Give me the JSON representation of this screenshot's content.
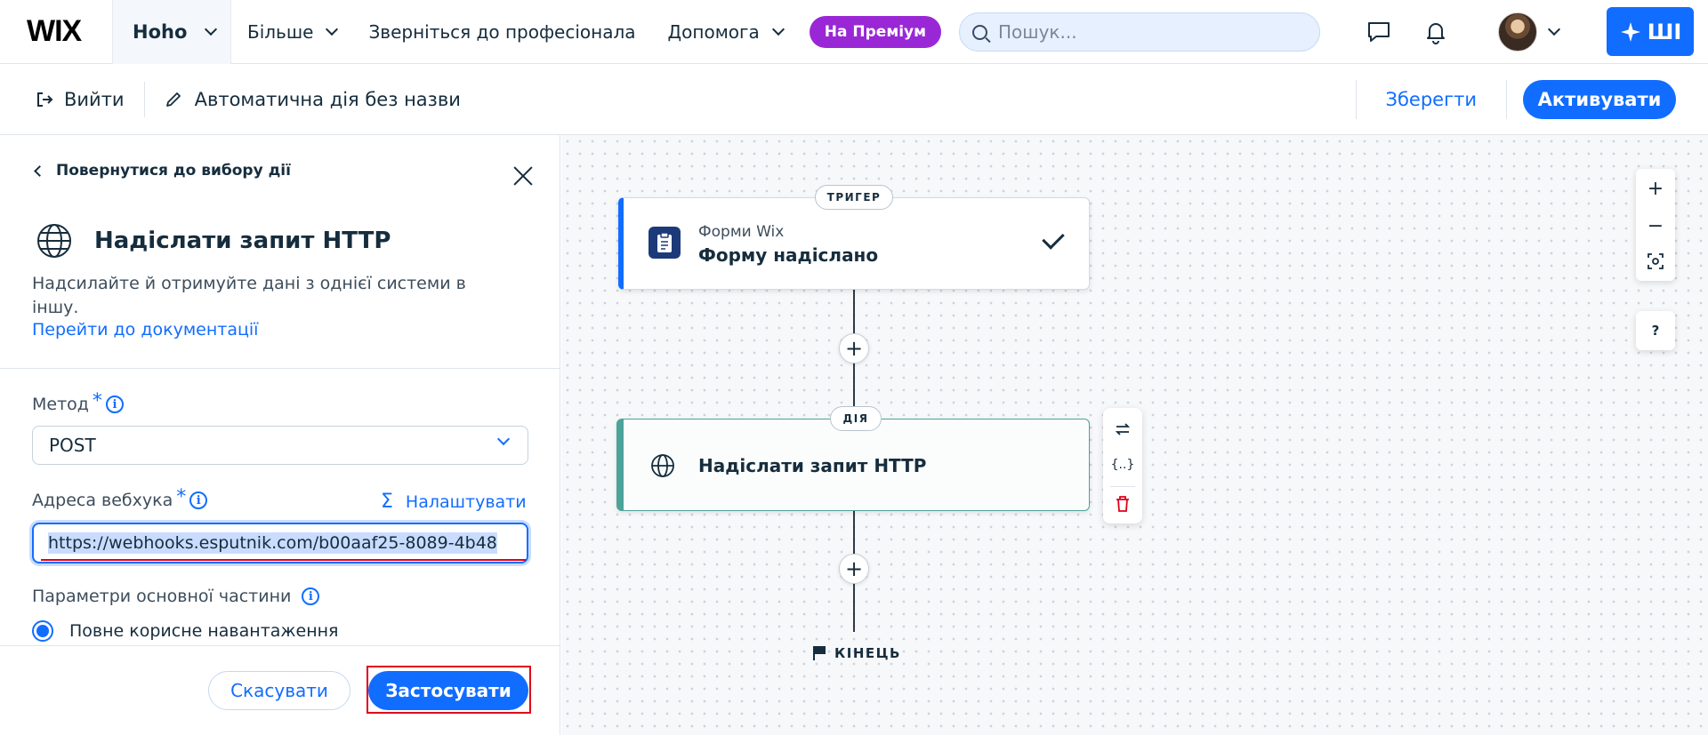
{
  "topbar": {
    "logo": "WIX",
    "site_name": "Hoho",
    "nav": [
      "Більше",
      "Зверніться до професіонала",
      "Допомога"
    ],
    "premium_label": "На Преміум",
    "search_placeholder": "Пошук...",
    "ai_label": "ШІ"
  },
  "toolbar": {
    "exit_label": "Вийти",
    "automation_title": "Автоматична дія без назви",
    "save_label": "Зберегти",
    "activate_label": "Активувати"
  },
  "panel": {
    "back_label": "Повернутися до вибору дії",
    "action_title": "Надіслати запит HTTP",
    "description": "Надсилайте й отримуйте дані з однієї системи в іншу.",
    "doc_link": "Перейти до документації",
    "method_label": "Метод",
    "method_value": "POST",
    "webhook_label": "Адреса вебхука",
    "customize_label": "Налаштувати",
    "webhook_value": "https://webhooks.esputnik.com/b00aaf25-8089-4b48",
    "body_params_label": "Параметри основної частини",
    "radio_option": "Повне корисне навантаження",
    "cancel_label": "Скасувати",
    "apply_label": "Застосувати",
    "required_mark": "*",
    "info_mark": "i"
  },
  "canvas": {
    "trigger_pill": "ТРИГЕР",
    "trigger_app": "Форми Wix",
    "trigger_title": "Форму надіслано",
    "action_pill": "ДІЯ",
    "action_title": "Надіслати запит HTTP",
    "end_label": "КІНЕЦЬ",
    "zoom_in": "+",
    "zoom_out": "−",
    "help": "?",
    "add": "+",
    "vars_tool": "{..}"
  },
  "colors": {
    "accent": "#116dff",
    "premium": "#9a27d5",
    "action_border": "#4ca39a",
    "highlight_red": "#e0001a"
  }
}
